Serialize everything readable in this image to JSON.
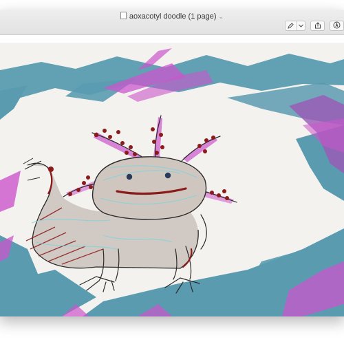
{
  "window": {
    "title": "aoxacotyl doodle (1 page)"
  },
  "toolbar": {
    "markup_icon": "pen-icon",
    "markup_menu_icon": "chevron-down-icon",
    "share_icon": "share-icon",
    "annotate_icon": "annotate-icon"
  },
  "document": {
    "subject": "axolotl doodle",
    "colors": {
      "paper": "#f4f2ee",
      "teal": "#5a9bb0",
      "magenta": "#cc55cc",
      "purple": "#9b59b6",
      "body_fill": "#cfc6c0",
      "outline": "#2a2a2a",
      "red": "#8b1a1a",
      "cyan": "#7fd3dc"
    }
  }
}
